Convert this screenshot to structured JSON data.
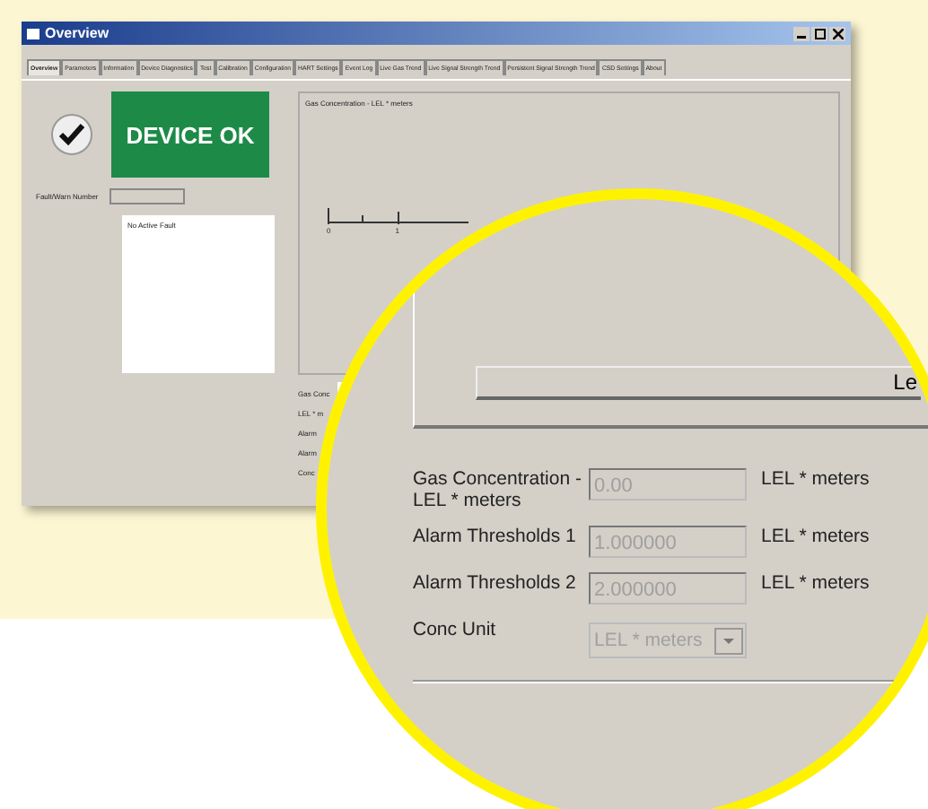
{
  "window": {
    "title": "Overview"
  },
  "tabs": [
    {
      "label": "Overview",
      "selected": true
    },
    {
      "label": "Parameters",
      "selected": false
    },
    {
      "label": "Information",
      "selected": false
    },
    {
      "label": "Device Diagnostics",
      "selected": false
    },
    {
      "label": "Test",
      "selected": false
    },
    {
      "label": "Calibration",
      "selected": false
    },
    {
      "label": "Configuration",
      "selected": false
    },
    {
      "label": "HART Settings",
      "selected": false
    },
    {
      "label": "Event Log",
      "selected": false
    },
    {
      "label": "Live Gas Trend",
      "selected": false
    },
    {
      "label": "Live Signal Strength Trend",
      "selected": false
    },
    {
      "label": "Persistent Signal Strength Trend",
      "selected": false
    },
    {
      "label": "CSD Settings",
      "selected": false
    },
    {
      "label": "About",
      "selected": false
    }
  ],
  "status": {
    "text": "DEVICE OK",
    "ok": true
  },
  "fault": {
    "label": "Fault/Warn Number"
  },
  "fault_list": [
    "No Active Fault"
  ],
  "chart": {
    "title": "Gas Concentration - LEL * meters",
    "tick_labels": [
      "0",
      "1"
    ]
  },
  "small_labels": [
    "Gas Conc",
    "LEL * m",
    "Alarm",
    "Alarm",
    "Conc"
  ],
  "magnifier": {
    "scrollbar_text": "Le",
    "rows": [
      {
        "kind": "field",
        "label": "Gas Concentration - LEL * meters",
        "value": "0.00",
        "unit": "LEL * meters",
        "disabled": true
      },
      {
        "kind": "field",
        "label": "Alarm Thresholds 1",
        "value": "1.000000",
        "unit": "LEL * meters",
        "disabled": true
      },
      {
        "kind": "field",
        "label": "Alarm Thresholds 2",
        "value": "2.000000",
        "unit": "LEL * meters",
        "disabled": true
      },
      {
        "kind": "dropdown",
        "label": "Conc Unit",
        "value": "LEL * meters",
        "disabled": true
      }
    ]
  }
}
